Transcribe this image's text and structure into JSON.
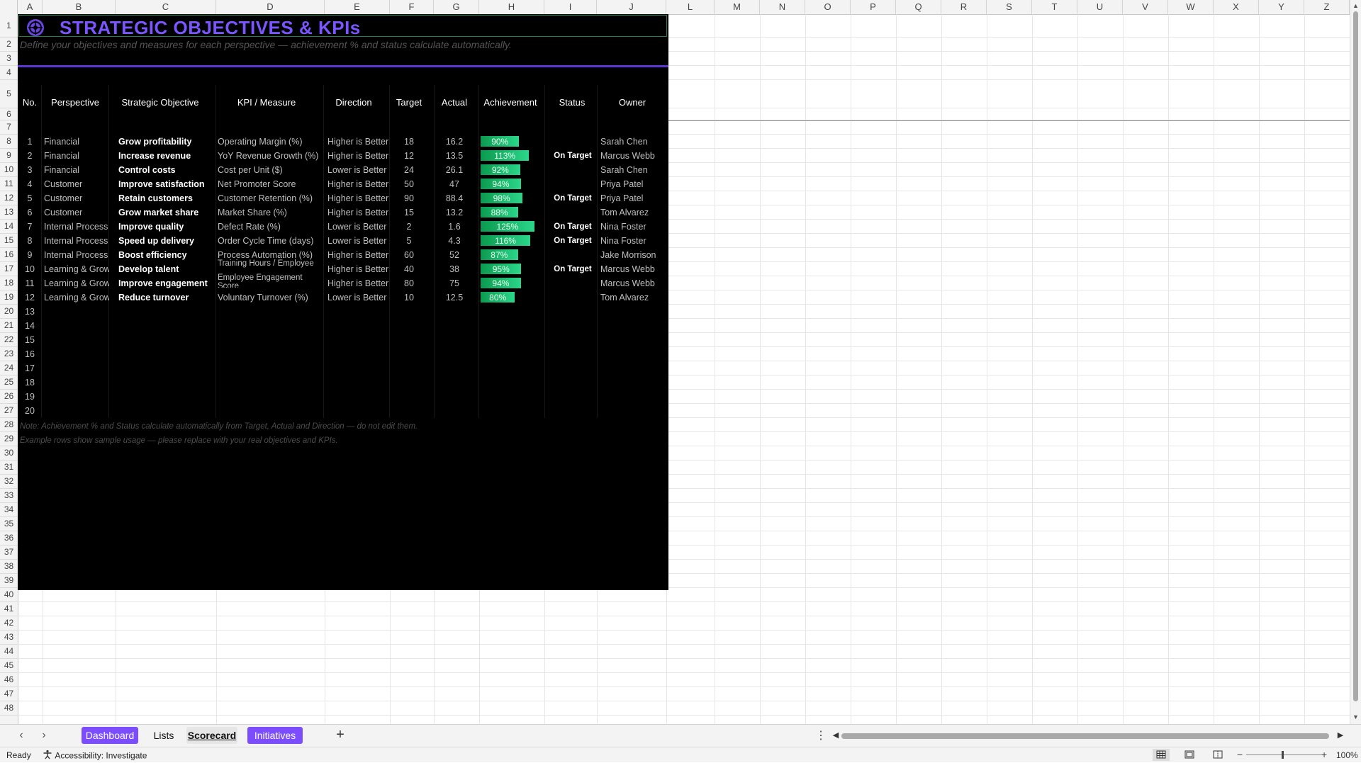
{
  "columns": [
    "A",
    "B",
    "C",
    "D",
    "E",
    "F",
    "G",
    "H",
    "I",
    "J",
    "L",
    "M",
    "N",
    "O",
    "P",
    "Q",
    "R",
    "S",
    "T",
    "U",
    "V",
    "W",
    "X",
    "Y",
    "Z"
  ],
  "rows": [
    "1",
    "2",
    "3",
    "4",
    "5",
    "6",
    "7",
    "8",
    "9",
    "10",
    "11",
    "12",
    "13",
    "14",
    "15",
    "16",
    "17",
    "18",
    "19",
    "20",
    "21",
    "22",
    "23",
    "24",
    "25",
    "26",
    "27",
    "28",
    "29",
    "30",
    "31",
    "32",
    "33",
    "34",
    "35",
    "36",
    "37",
    "38",
    "39",
    "40",
    "41",
    "42",
    "43",
    "44",
    "45",
    "46",
    "47",
    "48"
  ],
  "title": "STRATEGIC OBJECTIVES & KPIs",
  "subtitle": "Define your objectives and measures for each perspective — achievement % and status calculate automatically.",
  "headers": {
    "no": "No.",
    "perspective": "Perspective",
    "objective": "Strategic Objective",
    "kpi": "KPI / Measure",
    "direction": "Direction",
    "target": "Target",
    "actual": "Actual",
    "achievement": "Achievement",
    "status": "Status",
    "owner": "Owner"
  },
  "objectives": [
    {
      "no": "1",
      "perspective": "Financial",
      "objective": "Grow profitability",
      "kpi": "Operating Margin (%)",
      "direction": "Higher is Better",
      "target": "18",
      "actual": "16.2",
      "achievement": "90%",
      "achievement_value": 90,
      "status": "",
      "owner": "Sarah Chen"
    },
    {
      "no": "2",
      "perspective": "Financial",
      "objective": "Increase revenue",
      "kpi": "YoY Revenue Growth (%)",
      "direction": "Higher is Better",
      "target": "12",
      "actual": "13.5",
      "achievement": "113%",
      "achievement_value": 113,
      "status": "On Target",
      "owner": "Marcus Webb"
    },
    {
      "no": "3",
      "perspective": "Financial",
      "objective": "Control costs",
      "kpi": "Cost per Unit ($)",
      "direction": "Lower is Better",
      "target": "24",
      "actual": "26.1",
      "achievement": "92%",
      "achievement_value": 92,
      "status": "",
      "owner": "Sarah Chen"
    },
    {
      "no": "4",
      "perspective": "Customer",
      "objective": "Improve satisfaction",
      "kpi": "Net Promoter Score",
      "direction": "Higher is Better",
      "target": "50",
      "actual": "47",
      "achievement": "94%",
      "achievement_value": 94,
      "status": "",
      "owner": "Priya Patel"
    },
    {
      "no": "5",
      "perspective": "Customer",
      "objective": "Retain customers",
      "kpi": "Customer Retention (%)",
      "direction": "Higher is Better",
      "target": "90",
      "actual": "88.4",
      "achievement": "98%",
      "achievement_value": 98,
      "status": "On Target",
      "owner": "Priya Patel"
    },
    {
      "no": "6",
      "perspective": "Customer",
      "objective": "Grow market share",
      "kpi": "Market Share (%)",
      "direction": "Higher is Better",
      "target": "15",
      "actual": "13.2",
      "achievement": "88%",
      "achievement_value": 88,
      "status": "",
      "owner": "Tom Alvarez"
    },
    {
      "no": "7",
      "perspective": "Internal Process",
      "objective": "Improve quality",
      "kpi": "Defect Rate (%)",
      "direction": "Lower is Better",
      "target": "2",
      "actual": "1.6",
      "achievement": "125%",
      "achievement_value": 125,
      "status": "On Target",
      "owner": "Nina Foster"
    },
    {
      "no": "8",
      "perspective": "Internal Process",
      "objective": "Speed up delivery",
      "kpi": "Order Cycle Time (days)",
      "direction": "Lower is Better",
      "target": "5",
      "actual": "4.3",
      "achievement": "116%",
      "achievement_value": 116,
      "status": "On Target",
      "owner": "Nina Foster"
    },
    {
      "no": "9",
      "perspective": "Internal Process",
      "objective": "Boost efficiency",
      "kpi": "Process Automation (%)",
      "direction": "Higher is Better",
      "target": "60",
      "actual": "52",
      "achievement": "87%",
      "achievement_value": 87,
      "status": "",
      "owner": "Jake Morrison"
    },
    {
      "no": "10",
      "perspective": "Learning & Growth",
      "objective": "Develop talent",
      "kpi": "Training Hours / Employee",
      "direction": "Higher is Better",
      "target": "40",
      "actual": "38",
      "achievement": "95%",
      "achievement_value": 95,
      "status": "On Target",
      "owner": "Marcus Webb"
    },
    {
      "no": "11",
      "perspective": "Learning & Growth",
      "objective": "Improve engagement",
      "kpi": "Employee Engagement Score",
      "direction": "Higher is Better",
      "target": "80",
      "actual": "75",
      "achievement": "94%",
      "achievement_value": 94,
      "status": "",
      "owner": "Marcus Webb"
    },
    {
      "no": "12",
      "perspective": "Learning & Growth",
      "objective": "Reduce turnover",
      "kpi": "Voluntary Turnover (%)",
      "direction": "Lower is Better",
      "target": "10",
      "actual": "12.5",
      "achievement": "80%",
      "achievement_value": 80,
      "status": "",
      "owner": "Tom Alvarez"
    }
  ],
  "empty_rows": [
    "13",
    "14",
    "15",
    "16",
    "17",
    "18",
    "19",
    "20"
  ],
  "notes": [
    "Note: Achievement % and Status calculate automatically from Target, Actual and Direction — do not edit them.",
    "Example rows show sample usage — please replace with your real objectives and KPIs."
  ],
  "tabs": [
    {
      "label": "Dashboard",
      "style": "purple"
    },
    {
      "label": "Lists",
      "style": "plain"
    },
    {
      "label": "Scorecard",
      "style": "active"
    },
    {
      "label": "Initiatives",
      "style": "purple"
    }
  ],
  "status_bar": {
    "ready": "Ready",
    "accessibility": "Accessibility: Investigate",
    "zoom": "100%"
  },
  "colors": {
    "title": "#7b55ff",
    "accent_line": "#5b35d5",
    "bar_start": "#0b9a4f",
    "bar_end": "#2bd68a",
    "tab_purple": "#7b4dff",
    "sheet_bg": "#000000"
  }
}
